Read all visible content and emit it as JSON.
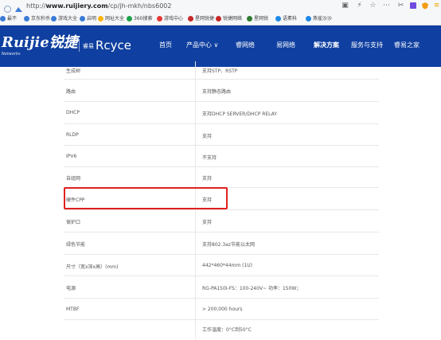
{
  "browser": {
    "url_prefix": "http://",
    "url_domain": "www.ruijiery.com",
    "url_path": "/cp/jh-mkh/nbs6002",
    "bookmarks": [
      {
        "label": "最不",
        "color": "#3a7bd5"
      },
      {
        "label": "京东秒杀",
        "color": "#3a7bd5"
      },
      {
        "label": "游戏大全",
        "color": "#3a7bd5"
      },
      {
        "label": "启明",
        "color": "#3a7bd5"
      },
      {
        "label": "网址大全",
        "color": "#ffb300"
      },
      {
        "label": "360搜索",
        "color": "#1fa34a"
      },
      {
        "label": "游戏中心",
        "color": "#e53935"
      },
      {
        "label": "星网锐捷",
        "color": "#c62828"
      },
      {
        "label": "锐捷网络",
        "color": "#c62828"
      },
      {
        "label": "星网锐",
        "color": "#2e7d32"
      },
      {
        "label": "语素科",
        "color": "#1e88e5"
      },
      {
        "label": "燕雀沙沙",
        "color": "#1e88e5"
      }
    ]
  },
  "header": {
    "logo_text": "Ruijie锐捷",
    "logo_sub": "Networks",
    "brand2_small": "睿易",
    "brand2_text": "Rcyce",
    "nav": [
      "首页",
      "产品中心 ∨",
      "睿网络",
      "易网络",
      "解决方案",
      "服务与支持",
      "睿易之家"
    ]
  },
  "spec_rows": [
    {
      "label": "生成树",
      "value": "支持STP、RSTP"
    },
    {
      "label": "路由",
      "value": "支持静态路由"
    },
    {
      "label": "DHCP",
      "value": "支持DHCP SERVER/DHCP RELAY"
    },
    {
      "label": "RLDP",
      "value": "支持"
    },
    {
      "label": "IPV6",
      "value": "不支持"
    },
    {
      "label": "自组网",
      "value": "支持"
    },
    {
      "label": "硬件CPP",
      "value": "支持"
    },
    {
      "label": "保护口",
      "value": "支持"
    },
    {
      "label": "绿色节能",
      "value": "支持802.3az节能以太网"
    },
    {
      "label": "尺寸（宽x深x高）(mm)",
      "value": "442*460*44mm (1U)"
    },
    {
      "label": "电源",
      "value": "RG-PA150I-FS：100-240V~ 功率：150W；"
    },
    {
      "label": "MTBF",
      "value": "> 200,000 hours"
    },
    {
      "label": "",
      "value": "工作温度：0°C到50°C"
    }
  ]
}
